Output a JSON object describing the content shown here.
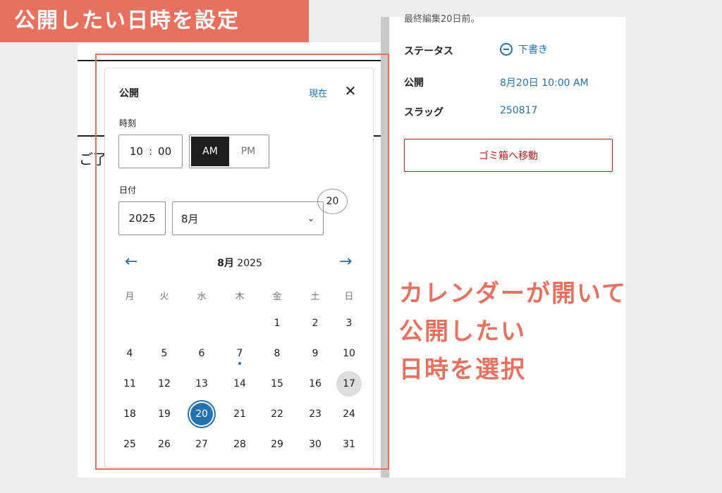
{
  "banner": {
    "text": "公開したい日時を設定"
  },
  "editor": {
    "fragment": "ご了"
  },
  "sidebar": {
    "last_edit": "最終編集20日前。",
    "rows": [
      {
        "label": "ステータス",
        "value": "下書き",
        "icon": "draft-circle-icon"
      },
      {
        "label": "公開",
        "value": "8月20日 10:00 AM"
      },
      {
        "label": "スラッグ",
        "value": "250817"
      }
    ],
    "trash_label": "ゴミ箱へ移動"
  },
  "popover": {
    "title": "公開",
    "now_label": "現在",
    "close_icon": "close-icon",
    "time_label": "時刻",
    "hour": "10",
    "colon": ":",
    "minute": "00",
    "am_label": "AM",
    "pm_label": "PM",
    "selected_period": "AM",
    "date_label": "日付",
    "year": "2025",
    "month": "8月",
    "day": "20"
  },
  "calendar": {
    "month_bold": "8月",
    "year": "2025",
    "prev_icon": "arrow-left-icon",
    "next_icon": "arrow-right-icon",
    "weekdays": [
      "月",
      "火",
      "水",
      "木",
      "金",
      "土",
      "日"
    ],
    "first_weekday_index": 4,
    "days_in_month": 31,
    "today": 17,
    "selected": 20,
    "marked": [
      7
    ]
  },
  "callout": {
    "lines": [
      "カレンダーが開いて",
      "公開したい",
      "日時を選択"
    ]
  },
  "colors": {
    "accent": "#e8705f",
    "link": "#2271b1",
    "danger": "#cc1818"
  }
}
